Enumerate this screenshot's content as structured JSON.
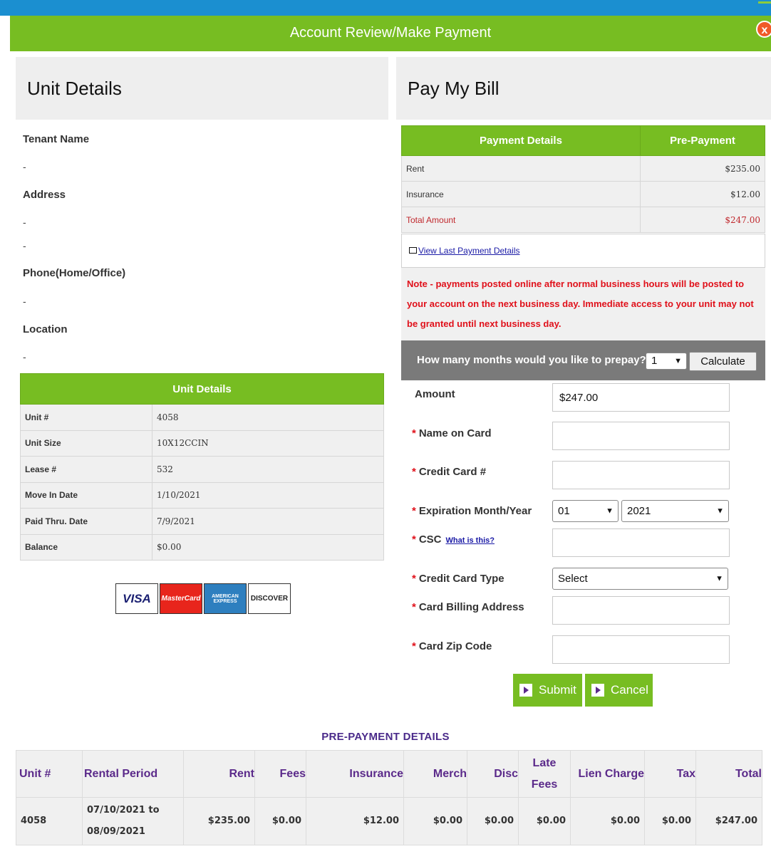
{
  "header": {
    "title": "Account Review/Make Payment",
    "close_label": "x"
  },
  "unit_panel": {
    "title": "Unit Details",
    "fields": [
      {
        "label": "Tenant Name",
        "values": [
          "-"
        ]
      },
      {
        "label": "Address",
        "values": [
          "-",
          "-"
        ]
      },
      {
        "label": "Phone(Home/Office)",
        "values": [
          "-"
        ]
      },
      {
        "label": "Location",
        "values": [
          "-"
        ]
      }
    ],
    "table": {
      "header": "Unit Details",
      "rows": [
        {
          "label": "Unit #",
          "value": "4058"
        },
        {
          "label": "Unit Size",
          "value": "10X12CCIN"
        },
        {
          "label": "Lease #",
          "value": "532"
        },
        {
          "label": "Move In Date",
          "value": "1/10/2021"
        },
        {
          "label": "Paid Thru. Date",
          "value": "7/9/2021"
        },
        {
          "label": "Balance",
          "value": "$0.00"
        }
      ]
    },
    "cards": [
      "VISA",
      "MasterCard",
      "AMERICAN EXPRESS",
      "DISCOVER"
    ]
  },
  "pay_panel": {
    "title": "Pay My Bill",
    "table": {
      "col1": "Payment Details",
      "col2": "Pre-Payment",
      "rows": [
        {
          "label": "Rent",
          "value": "$235.00"
        },
        {
          "label": "Insurance",
          "value": "$12.00"
        },
        {
          "label": "Total Amount",
          "value": "$247.00"
        }
      ]
    },
    "view_link": "View Last Payment Details",
    "note": "Note - payments posted online after normal business hours will be posted to your account on the next business day. Immediate access to your unit may not be granted until next business day.",
    "prepay_label": "How many months would you like to prepay?:",
    "prepay_value": "1",
    "calculate_label": "Calculate",
    "form": {
      "amount_label": "Amount",
      "amount_value": "$247.00",
      "name_label": "Name on  Card",
      "card_number_label": "Credit Card #",
      "expiration_label": "Expiration Month/Year",
      "exp_month": "01",
      "exp_year": "2021",
      "csc_label": "CSC",
      "csc_link": "What is this?",
      "card_type_label": "Credit Card Type",
      "card_type_value": "Select",
      "billing_label": "Card Billing Address",
      "zip_label": "Card Zip Code",
      "required_mark": "*"
    },
    "submit_label": "Submit",
    "cancel_label": "Cancel"
  },
  "prepayment": {
    "title": "PRE-PAYMENT DETAILS",
    "headers": [
      "Unit #",
      "Rental Period",
      "Rent",
      "Fees",
      "Insurance",
      "Merch",
      "Disc",
      "Late Fees",
      "Lien Charge",
      "Tax",
      "Total"
    ],
    "row": [
      "4058",
      "07/10/2021 to 08/09/2021",
      "$235.00",
      "$0.00",
      "$12.00",
      "$0.00",
      "$0.00",
      "$0.00",
      "$0.00",
      "$0.00",
      "$247.00"
    ]
  },
  "colors": {
    "green": "#77bd22",
    "blue": "#1b8fd0",
    "purple": "#5b2a8a",
    "red": "#e0101a"
  }
}
